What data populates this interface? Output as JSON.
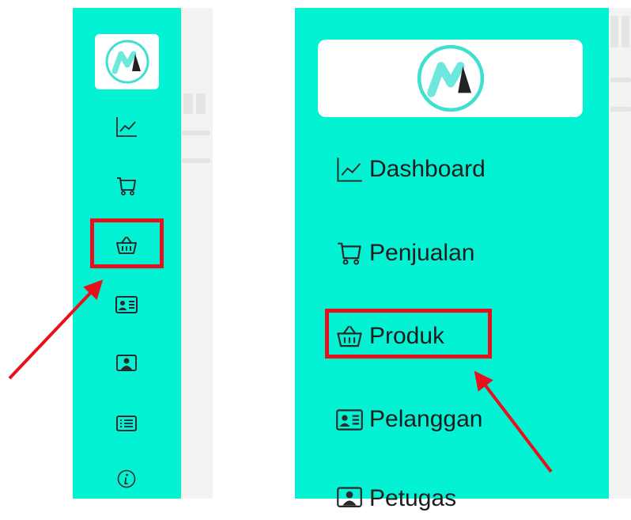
{
  "collapsed_sidebar": {
    "items": [
      {
        "icon": "chart-line-icon"
      },
      {
        "icon": "cart-icon"
      },
      {
        "icon": "basket-icon",
        "highlighted": true
      },
      {
        "icon": "id-card-icon"
      },
      {
        "icon": "person-screen-icon"
      },
      {
        "icon": "list-icon"
      },
      {
        "icon": "info-icon"
      }
    ]
  },
  "expanded_sidebar": {
    "items": [
      {
        "label": "Dashboard",
        "icon": "chart-line-icon"
      },
      {
        "label": "Penjualan",
        "icon": "cart-icon"
      },
      {
        "label": "Produk",
        "icon": "basket-icon",
        "highlighted": true
      },
      {
        "label": "Pelanggan",
        "icon": "id-card-icon"
      },
      {
        "label": "Petugas",
        "icon": "person-screen-icon"
      }
    ]
  },
  "colors": {
    "sidebar_bg": "#03f2d4",
    "highlight": "#e8101c",
    "icon": "#2a2a2a",
    "logo_teal": "#3ee0d0",
    "logo_dark": "#222222"
  }
}
